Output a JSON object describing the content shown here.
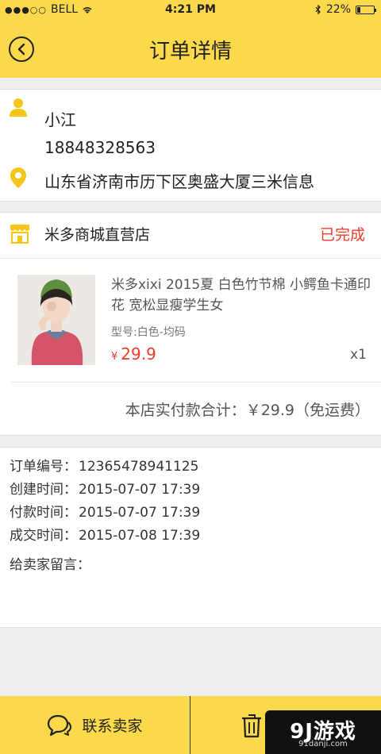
{
  "status_bar": {
    "carrier": "BELL",
    "signal": "●●●○○",
    "time": "4:21 PM",
    "battery": "22%"
  },
  "nav": {
    "title": "订单详情",
    "back_icon": "back-circle-icon"
  },
  "address": {
    "name": "小江",
    "phone": "18848328563",
    "address": "山东省济南市历下区奥盛大厦三米信息"
  },
  "order": {
    "store_name": "米多商城直营店",
    "status": "已完成",
    "product": {
      "title": "米多xixi 2015夏 白色竹节棉 小鳄鱼卡通印花 宽松显瘦学生女",
      "spec": "型号:白色-均码",
      "currency": "¥",
      "price": "29.9",
      "quantity": "x1"
    },
    "total": "本店实付款合计：￥29.9（免运费）"
  },
  "info": {
    "order_no": {
      "label": "订单编号：",
      "value": "12365478941125"
    },
    "created": {
      "label": "创建时间：",
      "value": "2015-07-07 17:39"
    },
    "paid": {
      "label": "付款时间：",
      "value": "2015-07-07 17:39"
    },
    "completed": {
      "label": "成交时间：",
      "value": "2015-07-08 17:39"
    },
    "message_label": "给卖家留言："
  },
  "bottom": {
    "contact_label": "联系卖家"
  },
  "watermark": {
    "logo": "9J游戏",
    "url": "91danji.com"
  },
  "colors": {
    "accent": "#fbd94a",
    "status_red": "#f03c2e",
    "icon_yellow": "#f5c518"
  }
}
